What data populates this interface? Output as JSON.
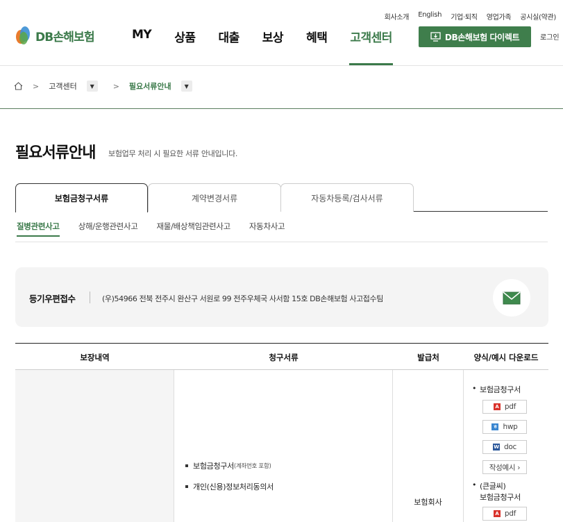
{
  "util_nav": [
    "회사소개",
    "English",
    "기업·퇴직",
    "영업가족",
    "공시실(약관)"
  ],
  "logo": {
    "text": "DB손해보험"
  },
  "gnb": [
    {
      "label": "MY",
      "active": false
    },
    {
      "label": "상품",
      "active": false
    },
    {
      "label": "대출",
      "active": false
    },
    {
      "label": "보상",
      "active": false
    },
    {
      "label": "혜택",
      "active": false
    },
    {
      "label": "고객센터",
      "active": true
    }
  ],
  "direct_button": "DB손해보험 다이렉트",
  "login": "로그인",
  "breadcrumb": {
    "level1": "고객센터",
    "level2": "필요서류안내"
  },
  "page": {
    "title": "필요서류안내",
    "subtitle": "보험업무 처리 시 필요한 서류 안내입니다."
  },
  "tabs": [
    "보험금청구서류",
    "계약변경서류",
    "자동차등록/검사서류"
  ],
  "subtabs": [
    "질병관련사고",
    "상해/운행관련사고",
    "재물/배상책임관련사고",
    "자동차사고"
  ],
  "mail": {
    "label": "등기우편접수",
    "address": "(우)54966 전북 전주시 완산구 서원로 99 전주우체국 사서함 15호 DB손해보험 사고접수팀"
  },
  "table": {
    "headers": [
      "보장내역",
      "청구서류",
      "발급처",
      "양식/예시 다운로드"
    ],
    "row": {
      "coverage": "",
      "documents": [
        {
          "name": "보험금청구서",
          "note": "(계좌번호 포함)"
        },
        {
          "name": "개인(신용)정보처리동의서",
          "note": ""
        }
      ],
      "issuer": "보험회사",
      "downloads": {
        "group1_title": "보험금청구서",
        "files1": [
          "pdf",
          "hwp",
          "doc"
        ],
        "example": "작성예시 ›",
        "group2_title_line1": "(큰글씨)",
        "group2_title_line2": "보험금청구서",
        "files2": [
          "pdf"
        ]
      }
    }
  },
  "colors": {
    "brand": "#3b7a4a",
    "pdf": "#d9322b",
    "hwp": "#3a86d0",
    "doc": "#2b579a"
  }
}
